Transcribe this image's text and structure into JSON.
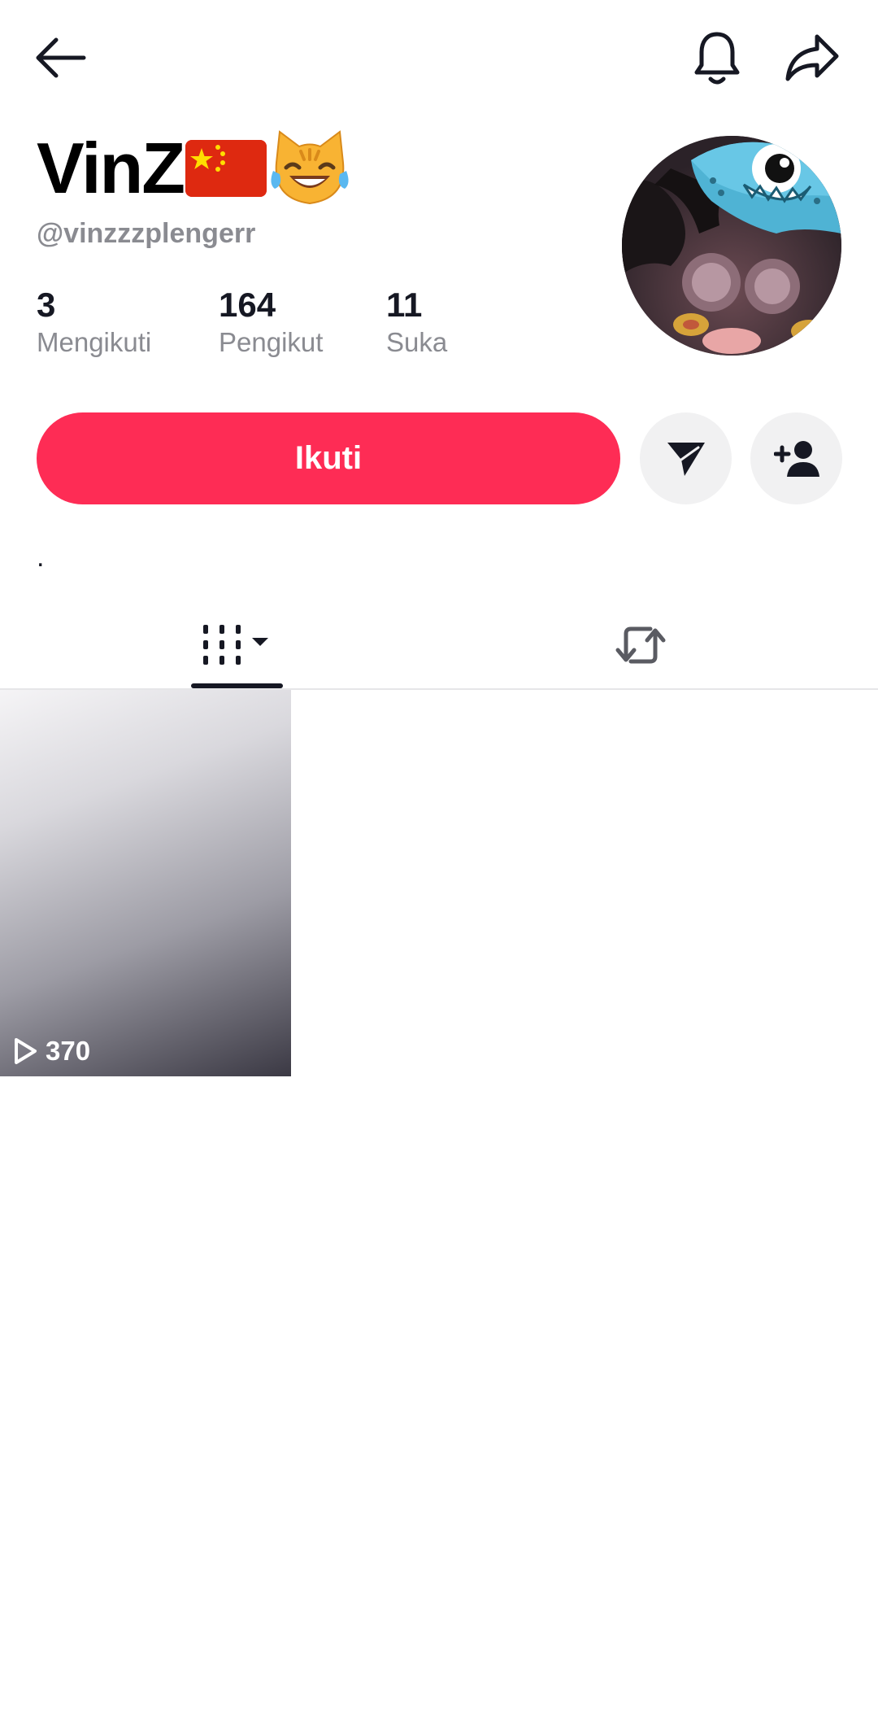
{
  "profile": {
    "display_name": "VinZ",
    "username": "@vinzzzplengerr",
    "bio": "."
  },
  "icons": {
    "back": "arrow-left-icon",
    "notifications": "bell-icon",
    "share": "share-icon",
    "flag": "china-flag-emoji",
    "emoji": "cat-tears-of-joy-emoji",
    "message": "paper-plane-icon",
    "add_friend": "person-add-icon",
    "videos_tab": "grid-bars-icon",
    "reposts_tab": "repost-icon",
    "play": "play-icon"
  },
  "stats": {
    "following": {
      "value": "3",
      "label": "Mengikuti"
    },
    "followers": {
      "value": "164",
      "label": "Pengikut"
    },
    "likes": {
      "value": "11",
      "label": "Suka"
    }
  },
  "actions": {
    "follow_label": "Ikuti"
  },
  "videos": [
    {
      "views": "370"
    }
  ],
  "colors": {
    "accent": "#fe2c55",
    "secondary_button": "#f1f1f2",
    "muted_text": "#8a8b91",
    "primary_text": "#161823"
  }
}
